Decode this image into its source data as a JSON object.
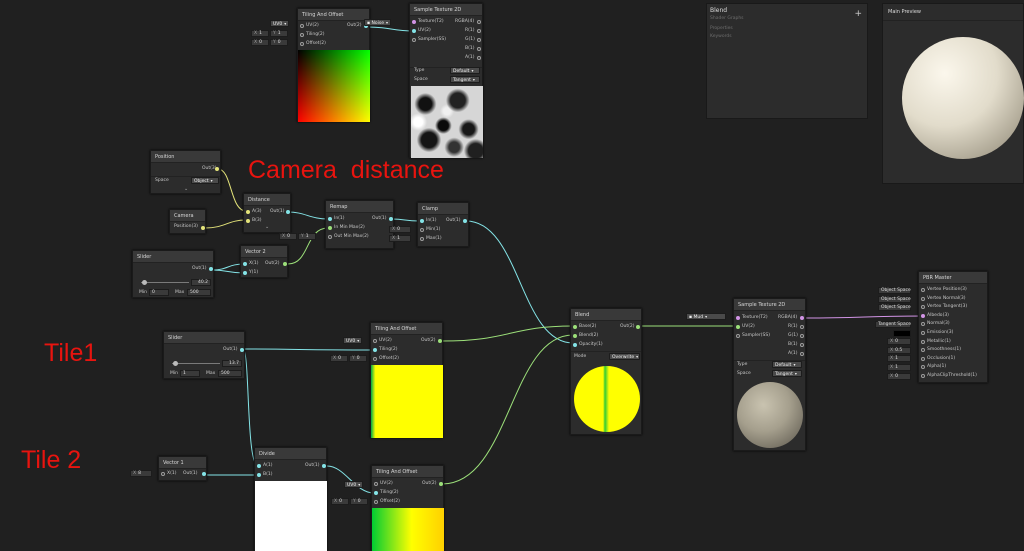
{
  "annotations": {
    "camera_distance": "Camera  distance",
    "tile1": "Tile1",
    "tile2": "Tile 2"
  },
  "nodes": {
    "tiling_top": {
      "title": "Tiling And Offset",
      "uv_label": "UV(2)",
      "tiling_label": "Tiling(2)",
      "offset_label": "Offset(2)",
      "out_label": "Out(2)",
      "uv_value": "UV0",
      "tiling_x": "1",
      "tiling_y": "1",
      "offset_x": "0",
      "offset_y": "0"
    },
    "noise_ref": {
      "label": "Noise"
    },
    "sample_top": {
      "title": "Sample Texture 2D",
      "texture_label": "Texture(T2)",
      "uv_label": "UV(2)",
      "sampler_label": "Sampler(SS)",
      "rgba_label": "RGBA(4)",
      "r_label": "R(1)",
      "g_label": "G(1)",
      "b_label": "B(1)",
      "a_label": "A(1)",
      "type_label": "Type",
      "type_value": "Default",
      "space_label": "Space",
      "space_value": "Tangent"
    },
    "position": {
      "title": "Position",
      "out_label": "Out(3)",
      "space_label": "Space",
      "space_value": "Object"
    },
    "camera": {
      "title": "Camera",
      "out_label": "Position(3)"
    },
    "distance": {
      "title": "Distance",
      "a_label": "A(3)",
      "b_label": "B(3)",
      "out_label": "Out(1)"
    },
    "remap": {
      "title": "Remap",
      "in_label": "In(1)",
      "inminmax_label": "In Min Max(2)",
      "outminmax_label": "Out Min Max(2)",
      "out_label": "Out(1)",
      "outmm_x": "0",
      "outmm_y": "1"
    },
    "clamp": {
      "title": "Clamp",
      "in_label": "In(1)",
      "min_label": "Min(1)",
      "max_label": "Max(1)",
      "out_label": "Out(1)",
      "min_value": "0",
      "max_value": "1"
    },
    "vector2": {
      "title": "Vector 2",
      "x_label": "X(1)",
      "y_label": "Y(1)",
      "out_label": "Out(2)"
    },
    "slider_top": {
      "title": "Slider",
      "out_label": "Out(1)",
      "value": "40.2",
      "min_label": "Min",
      "min_value": "0",
      "max_label": "Max",
      "max_value": "500"
    },
    "slider_mid": {
      "title": "Slider",
      "out_label": "Out(1)",
      "value": "13.7",
      "min_label": "Min",
      "min_value": "1",
      "max_label": "Max",
      "max_value": "500"
    },
    "tiling_mid": {
      "title": "Tiling And Offset",
      "uv_label": "UV(2)",
      "tiling_label": "Tiling(2)",
      "offset_label": "Offset(2)",
      "out_label": "Out(2)",
      "uv_value": "UV0",
      "offset_x": "0",
      "offset_y": "0"
    },
    "vector1": {
      "title": "Vector 1",
      "x_label": "X(1)",
      "out_label": "Out(1)",
      "x_value": "8"
    },
    "divide": {
      "title": "Divide",
      "a_label": "A(1)",
      "b_label": "B(1)",
      "out_label": "Out(1)"
    },
    "tiling_bot": {
      "title": "Tiling And Offset",
      "uv_label": "UV(2)",
      "tiling_label": "Tiling(2)",
      "offset_label": "Offset(2)",
      "out_label": "Out(2)",
      "uv_value": "UV0",
      "offset_x": "0",
      "offset_y": "0"
    },
    "blend": {
      "title": "Blend",
      "base_label": "Base(2)",
      "blend_label": "Blend(2)",
      "opacity_label": "Opacity(1)",
      "out_label": "Out(2)",
      "mode_label": "Mode",
      "mode_value": "Overwrite"
    },
    "mud_ref": {
      "label": "Mud"
    },
    "sample_mid": {
      "title": "Sample Texture 2D",
      "texture_label": "Texture(T2)",
      "uv_label": "UV(2)",
      "sampler_label": "Sampler(SS)",
      "rgba_label": "RGBA(4)",
      "r_label": "R(1)",
      "g_label": "G(1)",
      "b_label": "B(1)",
      "a_label": "A(1)",
      "type_label": "Type",
      "type_value": "Default",
      "space_label": "Space",
      "space_value": "Tangent"
    },
    "pbr": {
      "title": "PBR Master",
      "inputs": [
        "Vertex Position(3)",
        "Vertex Normal(3)",
        "Vertex Tangent(3)",
        "Albedo(3)",
        "Normal(3)",
        "Emission(3)",
        "Metallic(1)",
        "Smoothness(1)",
        "Occlusion(1)",
        "Alpha(1)",
        "AlphaClipThreshold(1)"
      ],
      "space_fields": [
        "Object Space",
        "Object Space",
        "Object Space"
      ],
      "normal_field": "Tangent Space",
      "metallic": "0",
      "smoothness": "0.5",
      "occlusion": "1",
      "alpha": "1",
      "clip": "0"
    }
  },
  "blackboard": {
    "title": "Blend",
    "subtitle": "Shader Graphs",
    "add_label": "+",
    "properties": "Properties",
    "keywords": "Keywords"
  },
  "main_preview": {
    "title": "Main Preview"
  },
  "colors": {
    "wire_cyan": "#84e4e7",
    "wire_yellow": "#e4e47a",
    "wire_green": "#9ce07a",
    "annotation_red": "#e8140f"
  }
}
